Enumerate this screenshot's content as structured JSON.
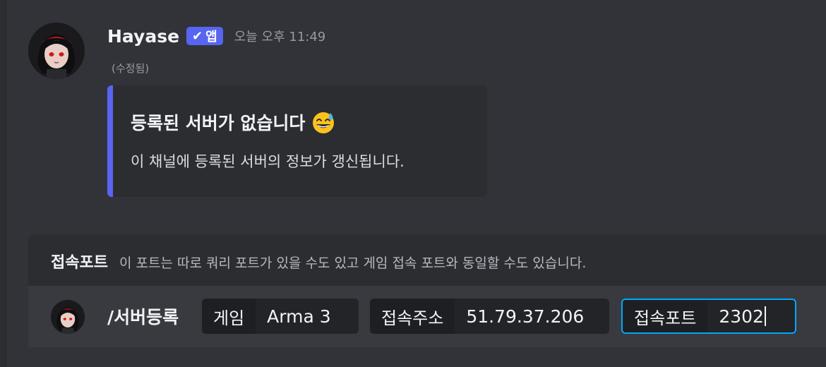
{
  "message": {
    "username": "Hayase",
    "badge_label": "앱",
    "timestamp": "오늘 오후 11:49",
    "edited_label": "(수정됨)",
    "embed": {
      "title": "등록된 서버가 없습니다",
      "description": "이 채널에 등록된 서버의 정보가 갱신됩니다.",
      "accent_color": "#5865f2"
    }
  },
  "command": {
    "option_name": "접속포트",
    "option_description": "이 포트는 따로 쿼리 포트가 있을 수도 있고 게임 접속 포트와 동일할 수도 있습니다.",
    "name": "/서버등록",
    "params": [
      {
        "key": "게임",
        "value": "Arma 3"
      },
      {
        "key": "접속주소",
        "value": "51.79.37.206"
      },
      {
        "key": "접속포트",
        "value": "2302"
      }
    ],
    "focus_color": "#00a8fc"
  }
}
